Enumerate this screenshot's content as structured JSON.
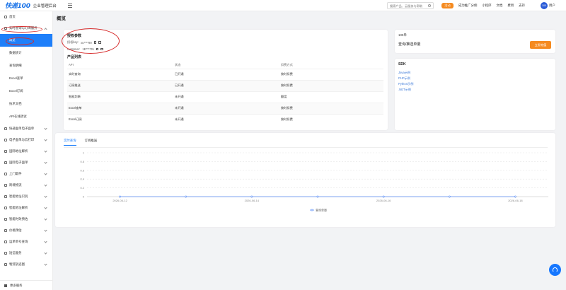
{
  "topbar": {
    "logo": "快递100",
    "product": "企业管理后台",
    "search_placeholder": "搜索产品、云服务与帮助",
    "badge_button": "活动",
    "links": [
      "成为推广分佣",
      "小程序",
      "文档",
      "费用",
      "支持"
    ],
    "avatar_text": "100",
    "username": "用户"
  },
  "sidebar": {
    "items": [
      {
        "label": "首页",
        "type": "top"
      },
      {
        "label": "实时查询与订阅服务",
        "type": "open"
      },
      {
        "label": "概览",
        "type": "sub",
        "active": true
      },
      {
        "label": "数据统计",
        "type": "sub"
      },
      {
        "label": "查询明细",
        "type": "sub"
      },
      {
        "label": "Excel查单",
        "type": "sub"
      },
      {
        "label": "Excel订阅",
        "type": "sub"
      },
      {
        "label": "技术文档",
        "type": "sub"
      },
      {
        "label": "API在线调试",
        "type": "sub"
      },
      {
        "label": "快递面单电子面单",
        "type": "group"
      },
      {
        "label": "电子面单与云打印",
        "type": "group"
      },
      {
        "label": "国际地址解析",
        "type": "group"
      },
      {
        "label": "国际电子面单",
        "type": "group"
      },
      {
        "label": "上门取件",
        "type": "group"
      },
      {
        "label": "跨境物流",
        "type": "group"
      },
      {
        "label": "智能地址识别",
        "type": "group"
      },
      {
        "label": "智能地址解析",
        "type": "group"
      },
      {
        "label": "智能时效预估",
        "type": "group"
      },
      {
        "label": "价格预估",
        "type": "group"
      },
      {
        "label": "运单单号查询",
        "type": "group"
      },
      {
        "label": "短信服务",
        "type": "group"
      },
      {
        "label": "物流轨迹图",
        "type": "group"
      }
    ],
    "footer": "更多服务"
  },
  "page_title": "概览",
  "keys": {
    "title": "授权参数",
    "rows": [
      {
        "label": "授权key:",
        "value": "xu****90"
      },
      {
        "label": "customer:",
        "value": "1E****05"
      }
    ]
  },
  "products": {
    "title": "产品列表",
    "headers": [
      "API",
      "状态",
      "扣费方式"
    ],
    "rows": [
      [
        "实时查询",
        "已开通",
        "按时扣费"
      ],
      [
        "订阅推送",
        "已开通",
        "按时扣费"
      ],
      [
        "智能判断",
        "未开通",
        "额度"
      ],
      [
        "Excel查单",
        "未开通",
        "按时扣费"
      ],
      [
        "Excel订阅",
        "未开通",
        "按时扣费"
      ]
    ]
  },
  "quota": {
    "title": "100单",
    "name": "查询/推送单量",
    "button": "立即充值"
  },
  "sdk": {
    "title": "SDK",
    "links": [
      "Java示例",
      "PHP示例",
      "Python示例",
      ".NET示例"
    ]
  },
  "chart_tabs": [
    "实时查询",
    "订阅推送"
  ],
  "chart_data": {
    "type": "line",
    "x": [
      "2026-06-12",
      "2026-06-13",
      "2026-06-14",
      "2026-06-15",
      "2026-06-16",
      "2026-06-17",
      "2026-06-18"
    ],
    "x_tick_labels": [
      "2026-06-12",
      "",
      "2026-06-14",
      "",
      "2026-06-16",
      "",
      "2026-06-18"
    ],
    "series": [
      {
        "name": "查询单量",
        "values": [
          0,
          0,
          0,
          0,
          0,
          0,
          0
        ],
        "color": "#5b8ff9"
      }
    ],
    "y_ticks": [
      0,
      0.2,
      0.4,
      0.6,
      0.8,
      1
    ],
    "ylim": [
      0,
      1
    ],
    "grid": true,
    "legend": "bottom-center"
  },
  "colors": {
    "primary": "#1e7ffa",
    "accent": "#f58a1f",
    "link": "#3a78d8",
    "annotation": "#d62b2b"
  }
}
